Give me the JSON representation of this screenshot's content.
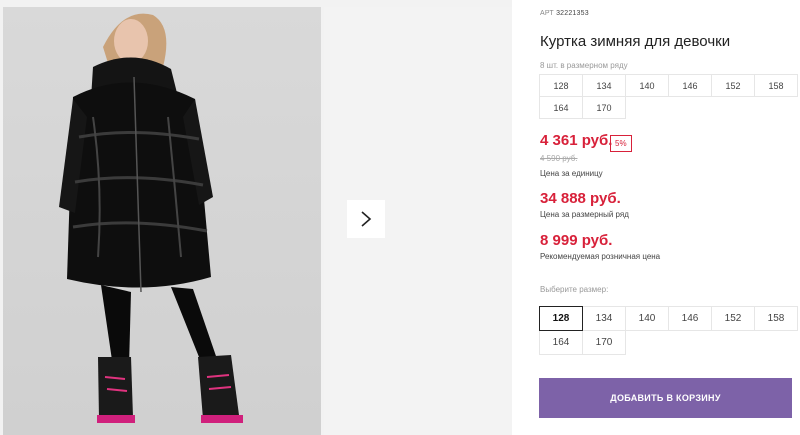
{
  "product": {
    "art_prefix": "АРТ",
    "art_number": "32221353",
    "title": "Куртка зимняя для девочки",
    "pack_note": "8 шт. в размерном ряду"
  },
  "pack_sizes": [
    "128",
    "134",
    "140",
    "146",
    "152",
    "158",
    "164",
    "170"
  ],
  "pricing": {
    "unit_price": "4 361 руб.",
    "discount_badge": "5%",
    "old_price": "4 590 руб.",
    "unit_caption": "Цена за единицу",
    "pack_price": "34 888 руб.",
    "pack_caption": "Цена за размерный ряд",
    "retail_price": "8 999 руб.",
    "retail_caption": "Рекомендуемая розничная цена"
  },
  "size_select": {
    "label": "Выберите размер:",
    "options": [
      "128",
      "134",
      "140",
      "146",
      "152",
      "158",
      "164",
      "170"
    ],
    "selected": "128"
  },
  "cart": {
    "button_label": "ДОБАВИТЬ В КОРЗИНУ"
  },
  "icons": {
    "next": "chevron-right-icon"
  },
  "colors": {
    "price_red": "#d8213a",
    "cart_purple": "#7d62a8"
  }
}
